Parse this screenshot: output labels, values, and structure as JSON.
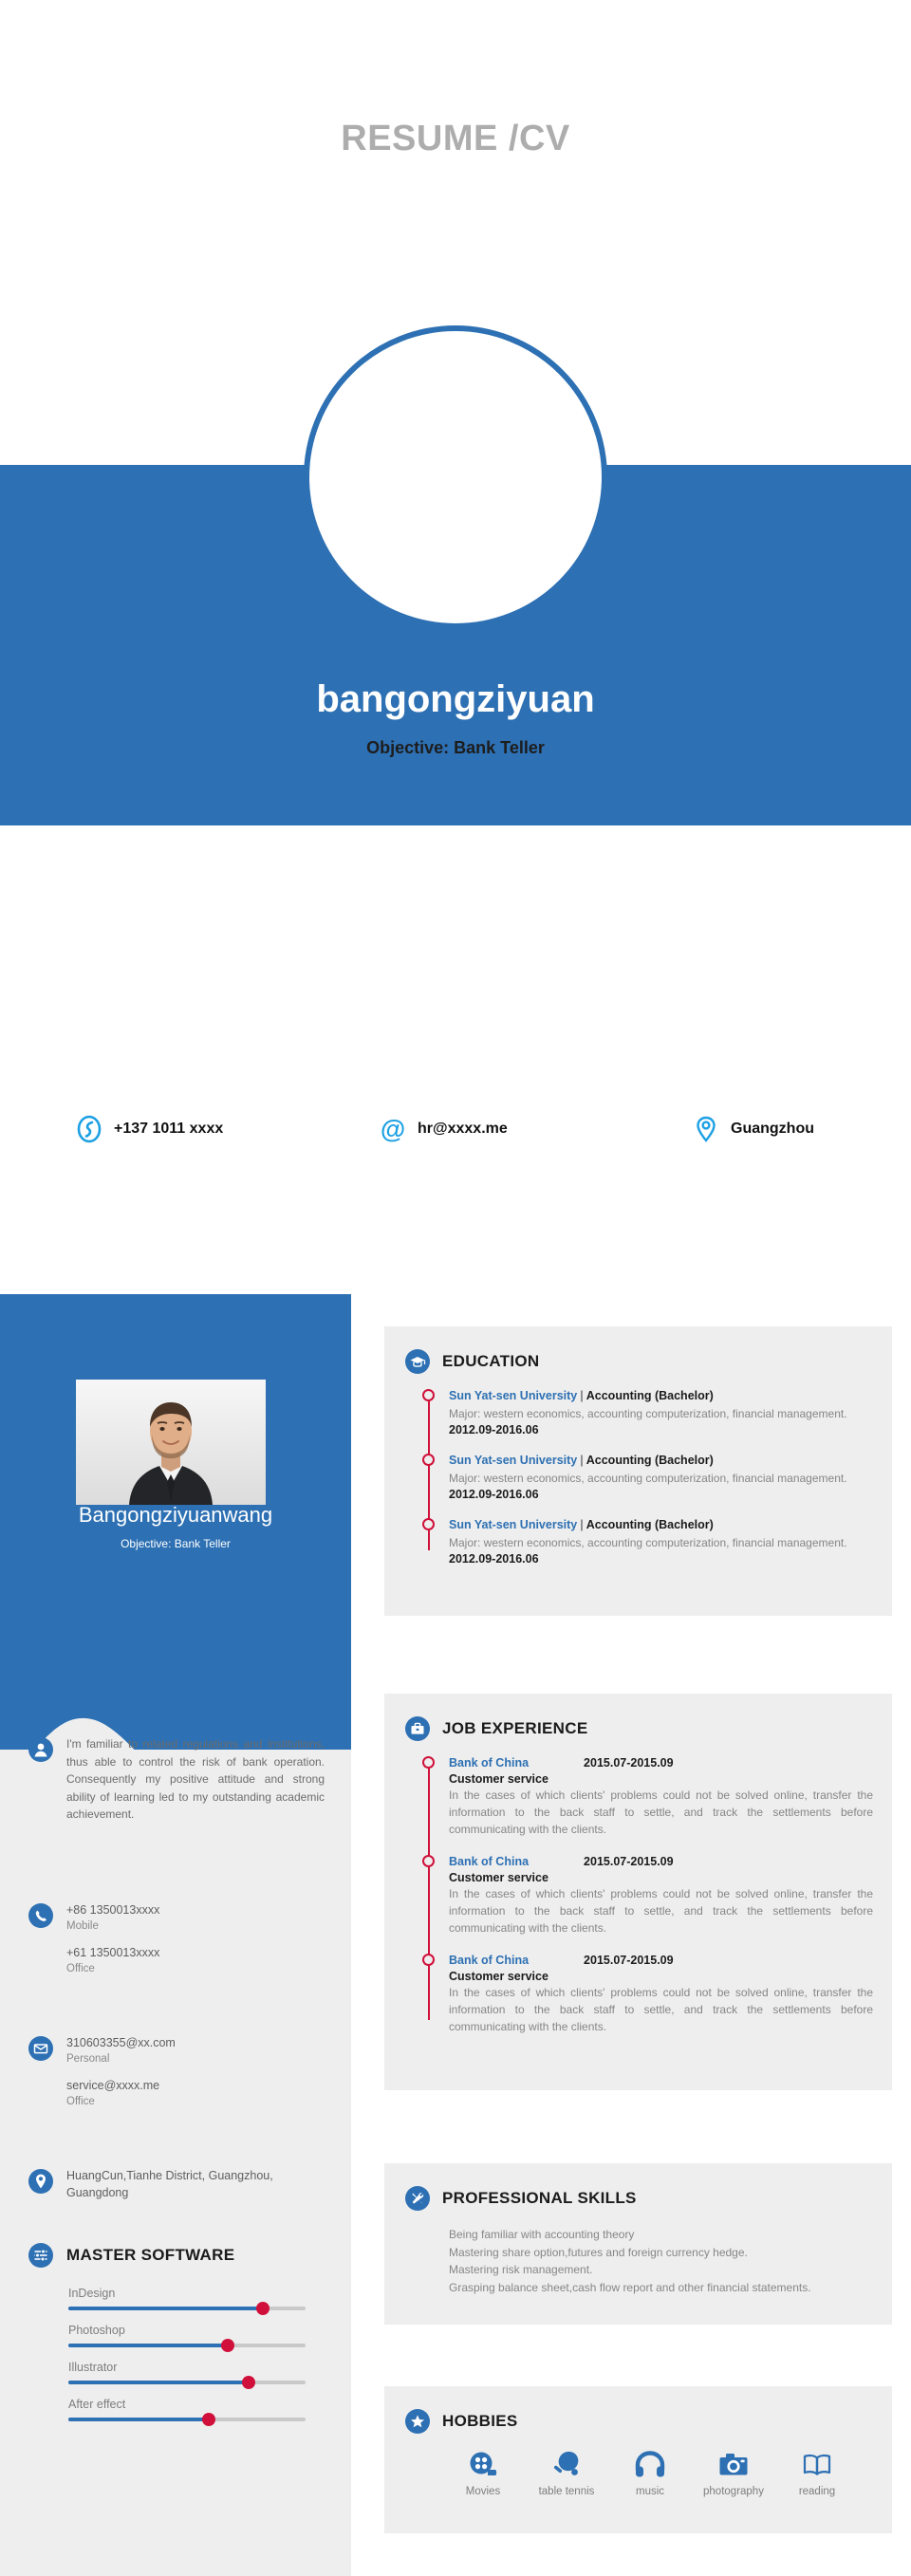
{
  "document": {
    "title": "RESUME /CV"
  },
  "banner": {
    "name": "bangongziyuan",
    "objective": "Objective: Bank Teller",
    "accent_color": "#2d70b3"
  },
  "contacts": [
    {
      "icon": "phone-icon",
      "value": "+137 1011 xxxx"
    },
    {
      "icon": "at-sign-icon",
      "value": "hr@xxxx.me"
    },
    {
      "icon": "location-icon",
      "value": "Guangzhou"
    }
  ],
  "sidebar": {
    "name": "Bangongziyuanwang",
    "objective": "Objective: Bank Teller",
    "photo_alt": "profile-photo",
    "statement": {
      "icon": "user-icon",
      "text": "I'm familiar to related regulations and institutions, thus able to control the risk of bank operation. Consequently my positive attitude and strong ability of learning led to my outstanding academic achievement."
    },
    "phone": {
      "icon": "phone-icon",
      "entries": [
        {
          "value": "+86 1350013xxxx",
          "label": "Mobile"
        },
        {
          "value": "+61 1350013xxxx",
          "label": "Office"
        }
      ]
    },
    "email": {
      "icon": "mail-icon",
      "entries": [
        {
          "value": "310603355@xx.com",
          "label": "Personal"
        },
        {
          "value": "service@xxxx.me",
          "label": "Office"
        }
      ]
    },
    "address": {
      "icon": "location-icon",
      "value": "HuangCun,Tianhe District, Guangzhou, Guangdong"
    },
    "software": {
      "icon": "sliders-icon",
      "heading": "MASTER SOFTWARE",
      "items": [
        {
          "name": "InDesign",
          "level": 82
        },
        {
          "name": "Photoshop",
          "level": 67
        },
        {
          "name": "Illustrator",
          "level": 76
        },
        {
          "name": "After effect",
          "level": 59
        }
      ]
    }
  },
  "education": {
    "icon": "graduation-cap-icon",
    "heading": "EDUCATION",
    "items": [
      {
        "school": "Sun Yat-sen University",
        "separator": "|",
        "degree": "Accounting (Bachelor)",
        "description": "Major: western economics, accounting computerization, financial management.",
        "date": "2012.09-2016.06"
      },
      {
        "school": "Sun Yat-sen University",
        "separator": "|",
        "degree": "Accounting (Bachelor)",
        "description": "Major: western economics, accounting computerization, financial management.",
        "date": "2012.09-2016.06"
      },
      {
        "school": "Sun Yat-sen University",
        "separator": "|",
        "degree": "Accounting (Bachelor)",
        "description": "Major: western economics, accounting computerization, financial management.",
        "date": "2012.09-2016.06"
      }
    ]
  },
  "job_experience": {
    "icon": "briefcase-icon",
    "heading": "JOB EXPERIENCE",
    "items": [
      {
        "company": "Bank of China",
        "date": "2015.07-2015.09",
        "role": "Customer service",
        "description": "In the cases of which clients' problems could not be solved online, transfer the information to the back staff to settle, and track the settlements before communicating with the clients."
      },
      {
        "company": "Bank of China",
        "date": "2015.07-2015.09",
        "role": "Customer service",
        "description": "In the cases of which clients' problems could not be solved online, transfer the information to the back staff to settle, and track the settlements before communicating with the clients."
      },
      {
        "company": "Bank of China",
        "date": "2015.07-2015.09",
        "role": "Customer service",
        "description": "In the cases of which clients' problems could not be solved online, transfer the information to the back staff to settle, and track the settlements before communicating with the clients."
      }
    ]
  },
  "professional_skills": {
    "icon": "tools-icon",
    "heading": "PROFESSIONAL SKILLS",
    "lines": [
      "Being familiar with accounting theory",
      "Mastering share option,futures and foreign currency hedge.",
      "Mastering risk management.",
      "Grasping balance sheet,cash flow report and other financial statements."
    ]
  },
  "hobbies": {
    "icon": "star-icon",
    "heading": "HOBBIES",
    "items": [
      {
        "icon": "film-reel-icon",
        "label": "Movies"
      },
      {
        "icon": "ping-pong-icon",
        "label": "table tennis"
      },
      {
        "icon": "headphones-icon",
        "label": "music"
      },
      {
        "icon": "camera-icon",
        "label": "photography"
      },
      {
        "icon": "book-icon",
        "label": "reading"
      }
    ]
  },
  "colors": {
    "blue": "#2d70b3",
    "red": "#d0103a",
    "card_bg": "#eeeeee",
    "muted_text": "#868686"
  }
}
